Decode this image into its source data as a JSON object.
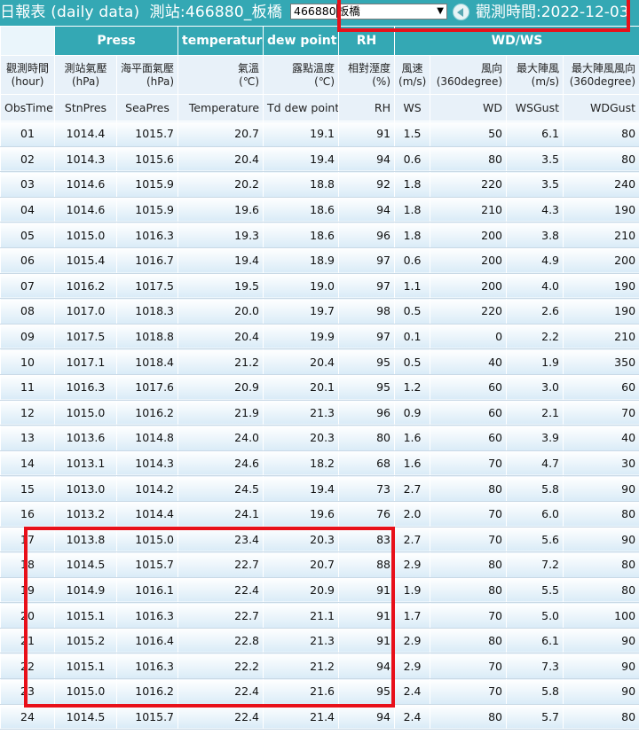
{
  "header": {
    "title_prefix": "日報表 (daily data)",
    "station_label": "測站:466880_板橋",
    "station_code": "466880",
    "station_name": "板橋",
    "obs_time_label": "觀測時間:2022-12-03"
  },
  "colors": {
    "header_bg": "#34a8b4",
    "highlight": "#e8101a",
    "subheader_bg": "#e8f1f9"
  },
  "table": {
    "groups": [
      "Press",
      "temperature",
      "dew point",
      "RH",
      "WD/WS"
    ],
    "zh_headers": [
      [
        "觀測時間",
        "(hour)"
      ],
      [
        "測站氣壓",
        "(hPa)"
      ],
      [
        "海平面氣壓",
        "(hPa)"
      ],
      [
        "氣溫",
        "(℃)"
      ],
      [
        "露點溫度",
        "(℃)"
      ],
      [
        "相對溼度",
        "(%)"
      ],
      [
        "風速",
        "(m/s)"
      ],
      [
        "風向",
        "(360degree)"
      ],
      [
        "最大陣風",
        "(m/s)"
      ],
      [
        "最大陣風風向",
        "(360degree)"
      ]
    ],
    "en_headers": [
      "ObsTime",
      "StnPres",
      "SeaPres",
      "Temperature",
      "Td dew point",
      "RH",
      "WS",
      "WD",
      "WSGust",
      "WDGust"
    ],
    "rows": [
      [
        "01",
        "1014.4",
        "1015.7",
        "20.7",
        "19.1",
        "91",
        "1.5",
        "50",
        "6.1",
        "80"
      ],
      [
        "02",
        "1014.3",
        "1015.6",
        "20.4",
        "19.4",
        "94",
        "0.6",
        "80",
        "3.5",
        "80"
      ],
      [
        "03",
        "1014.6",
        "1015.9",
        "20.2",
        "18.8",
        "92",
        "1.8",
        "220",
        "3.5",
        "240"
      ],
      [
        "04",
        "1014.6",
        "1015.9",
        "19.6",
        "18.6",
        "94",
        "1.8",
        "210",
        "4.3",
        "190"
      ],
      [
        "05",
        "1015.0",
        "1016.3",
        "19.3",
        "18.6",
        "96",
        "1.8",
        "200",
        "3.8",
        "210"
      ],
      [
        "06",
        "1015.4",
        "1016.7",
        "19.4",
        "18.9",
        "97",
        "0.6",
        "200",
        "4.9",
        "200"
      ],
      [
        "07",
        "1016.2",
        "1017.5",
        "19.5",
        "19.0",
        "97",
        "1.1",
        "200",
        "4.0",
        "190"
      ],
      [
        "08",
        "1017.0",
        "1018.3",
        "20.0",
        "19.7",
        "98",
        "0.5",
        "220",
        "2.6",
        "190"
      ],
      [
        "09",
        "1017.5",
        "1018.8",
        "20.4",
        "19.9",
        "97",
        "0.1",
        "0",
        "2.2",
        "210"
      ],
      [
        "10",
        "1017.1",
        "1018.4",
        "21.2",
        "20.4",
        "95",
        "0.5",
        "40",
        "1.9",
        "350"
      ],
      [
        "11",
        "1016.3",
        "1017.6",
        "20.9",
        "20.1",
        "95",
        "1.2",
        "60",
        "3.0",
        "60"
      ],
      [
        "12",
        "1015.0",
        "1016.2",
        "21.9",
        "21.3",
        "96",
        "0.9",
        "60",
        "2.1",
        "70"
      ],
      [
        "13",
        "1013.6",
        "1014.8",
        "24.0",
        "20.3",
        "80",
        "1.6",
        "60",
        "3.9",
        "40"
      ],
      [
        "14",
        "1013.1",
        "1014.3",
        "24.6",
        "18.2",
        "68",
        "1.6",
        "70",
        "4.7",
        "30"
      ],
      [
        "15",
        "1013.0",
        "1014.2",
        "24.5",
        "19.4",
        "73",
        "2.7",
        "80",
        "5.8",
        "90"
      ],
      [
        "16",
        "1013.2",
        "1014.4",
        "24.1",
        "19.6",
        "76",
        "2.0",
        "70",
        "6.0",
        "80"
      ],
      [
        "17",
        "1013.8",
        "1015.0",
        "23.4",
        "20.3",
        "83",
        "2.7",
        "70",
        "5.6",
        "90"
      ],
      [
        "18",
        "1014.5",
        "1015.7",
        "22.7",
        "20.7",
        "88",
        "2.9",
        "80",
        "7.2",
        "80"
      ],
      [
        "19",
        "1014.9",
        "1016.1",
        "22.4",
        "20.9",
        "91",
        "1.9",
        "80",
        "5.5",
        "80"
      ],
      [
        "20",
        "1015.1",
        "1016.3",
        "22.7",
        "21.1",
        "91",
        "1.7",
        "70",
        "5.0",
        "100"
      ],
      [
        "21",
        "1015.2",
        "1016.4",
        "22.8",
        "21.3",
        "91",
        "2.9",
        "80",
        "6.1",
        "90"
      ],
      [
        "22",
        "1015.1",
        "1016.3",
        "22.2",
        "21.2",
        "94",
        "2.9",
        "70",
        "7.3",
        "90"
      ],
      [
        "23",
        "1015.0",
        "1016.2",
        "22.4",
        "21.6",
        "95",
        "2.4",
        "70",
        "5.8",
        "90"
      ],
      [
        "24",
        "1014.5",
        "1015.7",
        "22.4",
        "21.4",
        "94",
        "2.4",
        "80",
        "5.7",
        "80"
      ]
    ]
  }
}
